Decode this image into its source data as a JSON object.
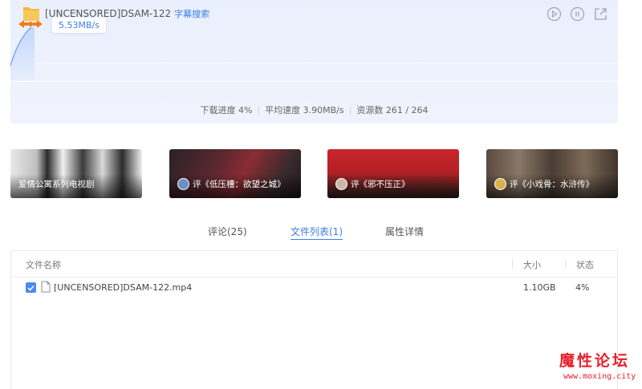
{
  "download": {
    "title": "[UNCENSORED]DSAM-122",
    "subtitle_link": "字幕搜索",
    "current_speed": "5.53MB/s",
    "stats": {
      "progress": "下载进度 4%",
      "avg_speed": "平均速度 3.90MB/s",
      "resources": "资源数 261 / 264"
    },
    "toolbar": [
      "play-icon",
      "pause-icon",
      "open-external-icon"
    ]
  },
  "cards": [
    {
      "label": "爱情公寓系列电视剧",
      "has_avatar": false
    },
    {
      "label": "评《低压槽：欲望之城》",
      "has_avatar": true
    },
    {
      "label": "评《邪不压正》",
      "has_avatar": true
    },
    {
      "label": "评《小戏骨：水浒传》",
      "has_avatar": true
    }
  ],
  "tabs": [
    {
      "label": "评论(25)",
      "active": false
    },
    {
      "label": "文件列表(1)",
      "active": true
    },
    {
      "label": "属性详情",
      "active": false
    }
  ],
  "file_list": {
    "columns": {
      "name": "文件名称",
      "size": "大小",
      "status": "状态"
    },
    "rows": [
      {
        "name": "[UNCENSORED]DSAM-122.mp4",
        "size": "1.10GB",
        "status": "4%",
        "checked": true
      }
    ]
  },
  "watermark": {
    "title": "魔性论坛",
    "url": "www.moxing.city"
  },
  "colors": {
    "accent": "#3c7de6",
    "watermark": "#e8202a",
    "panel_bg": "#eef2fd"
  }
}
